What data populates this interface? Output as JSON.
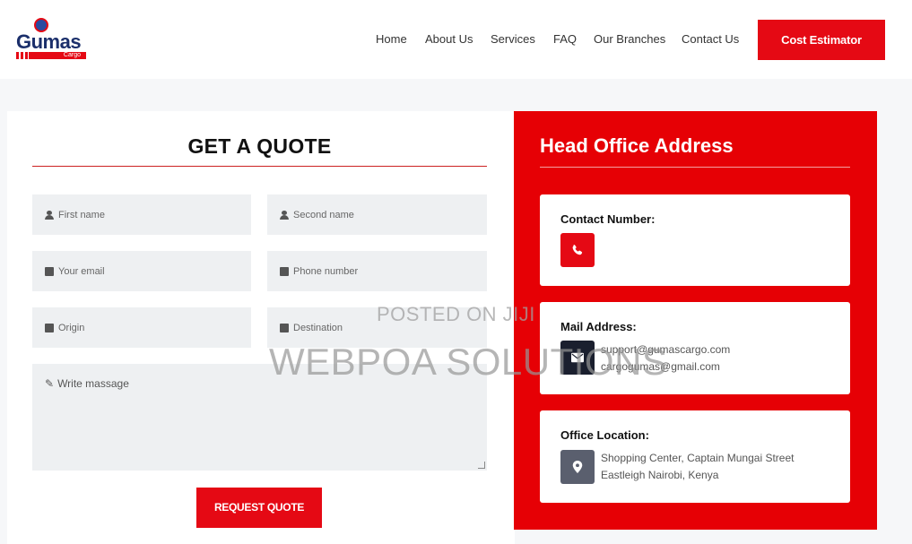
{
  "brand": {
    "name": "Gumas",
    "sub": "Cargo"
  },
  "nav": {
    "items": [
      "Home",
      "About Us",
      "Services",
      "FAQ",
      "Our Branches",
      "Contact Us"
    ],
    "cta": "Cost Estimator"
  },
  "quote": {
    "title": "GET A QUOTE",
    "fields": {
      "first_name": "First name",
      "second_name": "Second name",
      "email": "Your email",
      "phone": "Phone number",
      "origin": "Origin",
      "destination": "Destination",
      "message": "Write massage"
    },
    "submit": "REQUEST QUOTE"
  },
  "office": {
    "title": "Head Office Address",
    "contact_label": "Contact Number:",
    "mail_label": "Mail Address:",
    "mail_lines": [
      "support@gumascargo.com",
      "cargogumas@gmail.com"
    ],
    "location_label": "Office Location:",
    "location_lines": [
      "Shopping Center, Captain Mungai Street",
      "Eastleigh Nairobi, Kenya"
    ]
  },
  "watermark": {
    "line1": "POSTED ON JIJI",
    "line2": "WEBPOA SOLUTIONS"
  },
  "colors": {
    "accent": "#e50914",
    "mail_icon_bg": "#1a1f2e",
    "location_icon_bg": "#5a5f6e"
  },
  "icons": {
    "contact": "phone-icon",
    "mail": "envelope-icon",
    "location": "map-pin-icon"
  }
}
